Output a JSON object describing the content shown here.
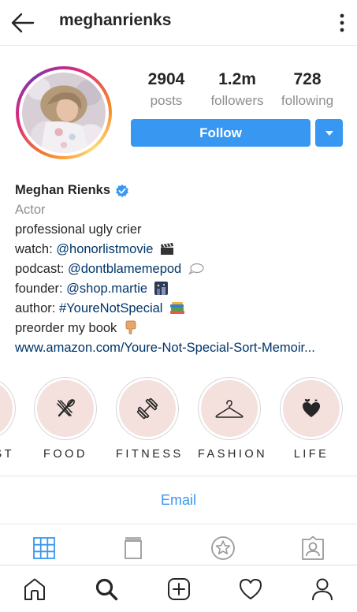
{
  "header": {
    "username": "meghanrienks"
  },
  "stats": [
    {
      "value": "2904",
      "label": "posts"
    },
    {
      "value": "1.2m",
      "label": "followers"
    },
    {
      "value": "728",
      "label": "following"
    }
  ],
  "actions": {
    "follow_label": "Follow",
    "email_label": "Email"
  },
  "bio": {
    "name": "Meghan Rienks",
    "category": "Actor",
    "line1": "professional ugly crier",
    "watch_prefix": "watch: ",
    "watch_handle": "@honorlistmovie",
    "podcast_prefix": "podcast: ",
    "podcast_handle": "@dontblamemepod",
    "founder_prefix": "founder: ",
    "founder_handle": "@shop.martie",
    "author_prefix": "author: ",
    "author_tag": "#YoureNotSpecial",
    "preorder": "preorder my book",
    "url": "www.amazon.com/Youre-Not-Special-Sort-Memoir..."
  },
  "highlights": [
    {
      "label": "ST",
      "icon": "partial-highlight"
    },
    {
      "label": "FOOD",
      "icon": "utensils-icon"
    },
    {
      "label": "FITNESS",
      "icon": "dumbbell-icon"
    },
    {
      "label": "FASHION",
      "icon": "hanger-icon"
    },
    {
      "label": "LIFE",
      "icon": "hearts-icon"
    }
  ],
  "tabs": [
    "grid-icon",
    "igtv-icon",
    "guides-icon",
    "tagged-icon"
  ],
  "bottom_nav": [
    "home-icon",
    "search-icon",
    "add-post-icon",
    "activity-heart-icon",
    "profile-icon"
  ],
  "colors": {
    "accent": "#3897f0",
    "link": "#003569",
    "highlight_bg": "#f4e0dc",
    "muted": "#8e8e8e"
  }
}
